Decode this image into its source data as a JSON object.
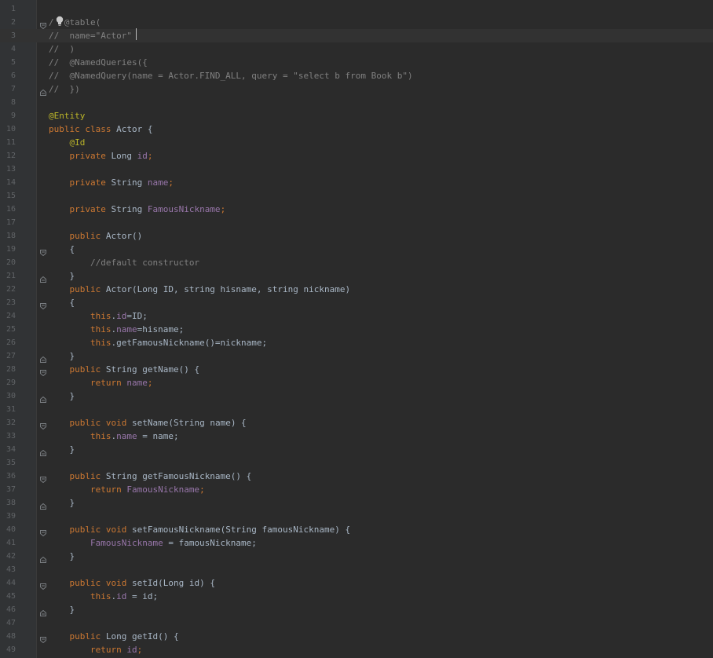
{
  "editor": {
    "caret_line": 3,
    "bulb_icon": "lightbulb-icon",
    "lines": [
      {
        "n": "1",
        "fold": "",
        "tokens": [
          {
            "t": "",
            "c": "plain"
          }
        ]
      },
      {
        "n": "2",
        "fold": "open",
        "tokens": [
          {
            "t": "/",
            "c": "comment"
          },
          {
            "t": "  ",
            "c": "comment"
          },
          {
            "t": "@table(",
            "c": "comment"
          }
        ]
      },
      {
        "n": "3",
        "fold": "",
        "tokens": [
          {
            "t": "//  name=\"Actor\"",
            "c": "comment"
          }
        ]
      },
      {
        "n": "4",
        "fold": "",
        "tokens": [
          {
            "t": "//  )",
            "c": "comment"
          }
        ]
      },
      {
        "n": "5",
        "fold": "",
        "tokens": [
          {
            "t": "//  @NamedQueries({",
            "c": "comment"
          }
        ]
      },
      {
        "n": "6",
        "fold": "",
        "tokens": [
          {
            "t": "//  @NamedQuery(name = Actor.FIND_ALL, query = \"select b from Book b\")",
            "c": "comment"
          }
        ]
      },
      {
        "n": "7",
        "fold": "close",
        "tokens": [
          {
            "t": "//  })",
            "c": "comment"
          }
        ]
      },
      {
        "n": "8",
        "fold": "",
        "tokens": [
          {
            "t": "",
            "c": "plain"
          }
        ]
      },
      {
        "n": "9",
        "fold": "",
        "tokens": [
          {
            "t": "@Entity",
            "c": "annotation"
          }
        ]
      },
      {
        "n": "10",
        "fold": "",
        "tokens": [
          {
            "t": "public class ",
            "c": "keyword"
          },
          {
            "t": "Actor {",
            "c": "plain"
          }
        ]
      },
      {
        "n": "11",
        "fold": "",
        "tokens": [
          {
            "t": "    ",
            "c": "plain"
          },
          {
            "t": "@Id",
            "c": "annotation"
          }
        ]
      },
      {
        "n": "12",
        "fold": "",
        "tokens": [
          {
            "t": "    ",
            "c": "plain"
          },
          {
            "t": "private ",
            "c": "keyword"
          },
          {
            "t": "Long ",
            "c": "plain"
          },
          {
            "t": "id",
            "c": "field"
          },
          {
            "t": ";",
            "c": "keyword"
          }
        ]
      },
      {
        "n": "13",
        "fold": "",
        "tokens": [
          {
            "t": "",
            "c": "plain"
          }
        ]
      },
      {
        "n": "14",
        "fold": "",
        "tokens": [
          {
            "t": "    ",
            "c": "plain"
          },
          {
            "t": "private ",
            "c": "keyword"
          },
          {
            "t": "String ",
            "c": "plain"
          },
          {
            "t": "name",
            "c": "field"
          },
          {
            "t": ";",
            "c": "keyword"
          }
        ]
      },
      {
        "n": "15",
        "fold": "",
        "tokens": [
          {
            "t": "",
            "c": "plain"
          }
        ]
      },
      {
        "n": "16",
        "fold": "",
        "tokens": [
          {
            "t": "    ",
            "c": "plain"
          },
          {
            "t": "private ",
            "c": "keyword"
          },
          {
            "t": "String ",
            "c": "plain"
          },
          {
            "t": "FamousNickname",
            "c": "field"
          },
          {
            "t": ";",
            "c": "keyword"
          }
        ]
      },
      {
        "n": "17",
        "fold": "",
        "tokens": [
          {
            "t": "",
            "c": "plain"
          }
        ]
      },
      {
        "n": "18",
        "fold": "",
        "tokens": [
          {
            "t": "    ",
            "c": "plain"
          },
          {
            "t": "public ",
            "c": "keyword"
          },
          {
            "t": "Actor()",
            "c": "plain"
          }
        ]
      },
      {
        "n": "19",
        "fold": "open",
        "tokens": [
          {
            "t": "    {",
            "c": "plain"
          }
        ]
      },
      {
        "n": "20",
        "fold": "",
        "tokens": [
          {
            "t": "        ",
            "c": "plain"
          },
          {
            "t": "//default constructor",
            "c": "comment"
          }
        ]
      },
      {
        "n": "21",
        "fold": "close",
        "tokens": [
          {
            "t": "    }",
            "c": "plain"
          }
        ]
      },
      {
        "n": "22",
        "fold": "",
        "tokens": [
          {
            "t": "    ",
            "c": "plain"
          },
          {
            "t": "public ",
            "c": "keyword"
          },
          {
            "t": "Actor(Long ID, string hisname, string nickname)",
            "c": "plain"
          }
        ]
      },
      {
        "n": "23",
        "fold": "open",
        "tokens": [
          {
            "t": "    {",
            "c": "plain"
          }
        ]
      },
      {
        "n": "24",
        "fold": "",
        "tokens": [
          {
            "t": "        ",
            "c": "plain"
          },
          {
            "t": "this",
            "c": "keyword"
          },
          {
            "t": ".",
            "c": "plain"
          },
          {
            "t": "id",
            "c": "field"
          },
          {
            "t": "=ID;",
            "c": "plain"
          }
        ]
      },
      {
        "n": "25",
        "fold": "",
        "tokens": [
          {
            "t": "        ",
            "c": "plain"
          },
          {
            "t": "this",
            "c": "keyword"
          },
          {
            "t": ".",
            "c": "plain"
          },
          {
            "t": "name",
            "c": "field"
          },
          {
            "t": "=hisname;",
            "c": "plain"
          }
        ]
      },
      {
        "n": "26",
        "fold": "",
        "tokens": [
          {
            "t": "        ",
            "c": "plain"
          },
          {
            "t": "this",
            "c": "keyword"
          },
          {
            "t": ".getFamousNickname()=nickname;",
            "c": "plain"
          }
        ]
      },
      {
        "n": "27",
        "fold": "close",
        "tokens": [
          {
            "t": "    }",
            "c": "plain"
          }
        ]
      },
      {
        "n": "28",
        "fold": "open",
        "tokens": [
          {
            "t": "    ",
            "c": "plain"
          },
          {
            "t": "public ",
            "c": "keyword"
          },
          {
            "t": "String getName() {",
            "c": "plain"
          }
        ]
      },
      {
        "n": "29",
        "fold": "",
        "tokens": [
          {
            "t": "        ",
            "c": "plain"
          },
          {
            "t": "return ",
            "c": "keyword"
          },
          {
            "t": "name",
            "c": "field"
          },
          {
            "t": ";",
            "c": "keyword"
          }
        ]
      },
      {
        "n": "30",
        "fold": "close",
        "tokens": [
          {
            "t": "    }",
            "c": "plain"
          }
        ]
      },
      {
        "n": "31",
        "fold": "",
        "tokens": [
          {
            "t": "",
            "c": "plain"
          }
        ]
      },
      {
        "n": "32",
        "fold": "open",
        "tokens": [
          {
            "t": "    ",
            "c": "plain"
          },
          {
            "t": "public void ",
            "c": "keyword"
          },
          {
            "t": "setName(String name) {",
            "c": "plain"
          }
        ]
      },
      {
        "n": "33",
        "fold": "",
        "tokens": [
          {
            "t": "        ",
            "c": "plain"
          },
          {
            "t": "this",
            "c": "keyword"
          },
          {
            "t": ".",
            "c": "plain"
          },
          {
            "t": "name",
            "c": "field"
          },
          {
            "t": " = name;",
            "c": "plain"
          }
        ]
      },
      {
        "n": "34",
        "fold": "close",
        "tokens": [
          {
            "t": "    }",
            "c": "plain"
          }
        ]
      },
      {
        "n": "35",
        "fold": "",
        "tokens": [
          {
            "t": "",
            "c": "plain"
          }
        ]
      },
      {
        "n": "36",
        "fold": "open",
        "tokens": [
          {
            "t": "    ",
            "c": "plain"
          },
          {
            "t": "public ",
            "c": "keyword"
          },
          {
            "t": "String getFamousNickname() {",
            "c": "plain"
          }
        ]
      },
      {
        "n": "37",
        "fold": "",
        "tokens": [
          {
            "t": "        ",
            "c": "plain"
          },
          {
            "t": "return ",
            "c": "keyword"
          },
          {
            "t": "FamousNickname",
            "c": "field"
          },
          {
            "t": ";",
            "c": "keyword"
          }
        ]
      },
      {
        "n": "38",
        "fold": "close",
        "tokens": [
          {
            "t": "    }",
            "c": "plain"
          }
        ]
      },
      {
        "n": "39",
        "fold": "",
        "tokens": [
          {
            "t": "",
            "c": "plain"
          }
        ]
      },
      {
        "n": "40",
        "fold": "open",
        "tokens": [
          {
            "t": "    ",
            "c": "plain"
          },
          {
            "t": "public void ",
            "c": "keyword"
          },
          {
            "t": "setFamousNickname(String famousNickname) {",
            "c": "plain"
          }
        ]
      },
      {
        "n": "41",
        "fold": "",
        "tokens": [
          {
            "t": "        ",
            "c": "plain"
          },
          {
            "t": "FamousNickname",
            "c": "field"
          },
          {
            "t": " = famousNickname;",
            "c": "plain"
          }
        ]
      },
      {
        "n": "42",
        "fold": "close",
        "tokens": [
          {
            "t": "    }",
            "c": "plain"
          }
        ]
      },
      {
        "n": "43",
        "fold": "",
        "tokens": [
          {
            "t": "",
            "c": "plain"
          }
        ]
      },
      {
        "n": "44",
        "fold": "open",
        "tokens": [
          {
            "t": "    ",
            "c": "plain"
          },
          {
            "t": "public void ",
            "c": "keyword"
          },
          {
            "t": "setId(Long id) {",
            "c": "plain"
          }
        ]
      },
      {
        "n": "45",
        "fold": "",
        "tokens": [
          {
            "t": "        ",
            "c": "plain"
          },
          {
            "t": "this",
            "c": "keyword"
          },
          {
            "t": ".",
            "c": "plain"
          },
          {
            "t": "id",
            "c": "field"
          },
          {
            "t": " = id;",
            "c": "plain"
          }
        ]
      },
      {
        "n": "46",
        "fold": "close",
        "tokens": [
          {
            "t": "    }",
            "c": "plain"
          }
        ]
      },
      {
        "n": "47",
        "fold": "",
        "tokens": [
          {
            "t": "",
            "c": "plain"
          }
        ]
      },
      {
        "n": "48",
        "fold": "open",
        "tokens": [
          {
            "t": "    ",
            "c": "plain"
          },
          {
            "t": "public ",
            "c": "keyword"
          },
          {
            "t": "Long getId() {",
            "c": "plain"
          }
        ]
      },
      {
        "n": "49",
        "fold": "",
        "tokens": [
          {
            "t": "        ",
            "c": "plain"
          },
          {
            "t": "return ",
            "c": "keyword"
          },
          {
            "t": "id",
            "c": "field"
          },
          {
            "t": ";",
            "c": "keyword"
          }
        ]
      }
    ]
  }
}
